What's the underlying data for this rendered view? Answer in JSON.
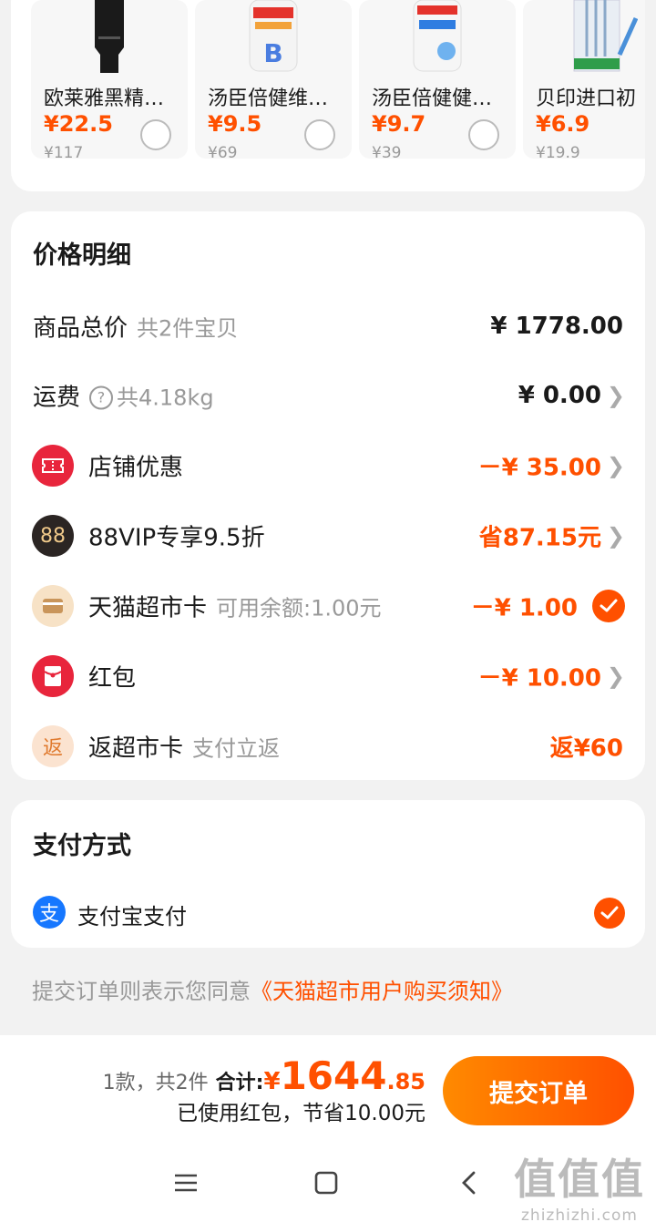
{
  "products": [
    {
      "name": "欧莱雅黑精华…",
      "price": "¥22.5",
      "original": "¥117"
    },
    {
      "name": "汤臣倍健维生…",
      "price": "¥9.5",
      "original": "¥69"
    },
    {
      "name": "汤臣倍健健力…",
      "price": "¥9.7",
      "original": "¥39"
    },
    {
      "name": "贝印进口初",
      "price": "¥6.9",
      "original": "¥19.9"
    }
  ],
  "price_detail": {
    "title": "价格明细",
    "subtotal": {
      "label": "商品总价",
      "sub": "共2件宝贝",
      "amount": "¥ 1778.00"
    },
    "shipping": {
      "label": "运费",
      "sub": "共4.18kg",
      "amount": "¥ 0.00"
    },
    "shop_discount": {
      "label": "店铺优惠",
      "amount": "－¥ 35.00"
    },
    "vip": {
      "label": "88VIP专享9.5折",
      "icon_text": "88",
      "amount": "省87.15元"
    },
    "supermarket_card": {
      "label": "天猫超市卡",
      "sub": "可用余额:1.00元",
      "amount": "－¥ 1.00"
    },
    "red_packet": {
      "label": "红包",
      "amount": "－¥ 10.00"
    },
    "cashback": {
      "label": "返超市卡",
      "icon_text": "返",
      "sub": "支付立返",
      "amount": "返¥60"
    }
  },
  "payment": {
    "title": "支付方式",
    "method_icon_text": "支",
    "method": "支付宝支付"
  },
  "agreement": {
    "prefix": "提交订单则表示您同意",
    "link": "《天猫超市用户购买须知》"
  },
  "bottom_bar": {
    "count": "1款，共2件",
    "total_label": "合计:",
    "total_yen": "¥",
    "total_int": "1644",
    "total_dec": ".85",
    "savings": "已使用红包，节省10.00元",
    "submit_label": "提交订单"
  },
  "watermark": {
    "big": "值值值",
    "small": "zhizhizhi.com"
  },
  "colors": {
    "accent": "#ff5000",
    "alipay": "#1677ff"
  }
}
